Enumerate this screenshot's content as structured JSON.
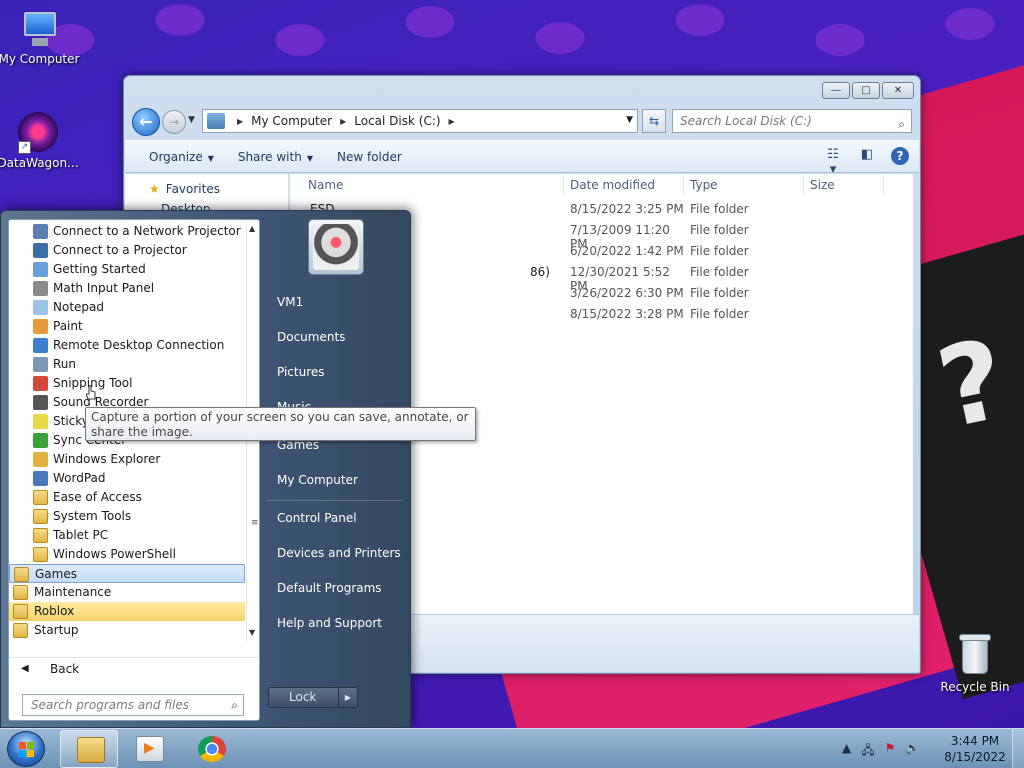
{
  "desktop": {
    "icons": [
      {
        "label": "My Computer",
        "icon": "computer-icon"
      },
      {
        "label": "DataWagon...",
        "icon": "datawagon-icon"
      },
      {
        "label": "Recycle Bin",
        "icon": "recycle-bin-icon"
      }
    ]
  },
  "explorer": {
    "window_controls": {
      "minimize": "—",
      "maximize": "□",
      "close": "✕"
    },
    "address": {
      "parts": [
        "My Computer",
        "Local Disk (C:)"
      ],
      "separator": "▶"
    },
    "search_placeholder": "Search Local Disk (C:)",
    "toolbar": {
      "organize": "Organize",
      "share_with": "Share with",
      "new_folder": "New folder"
    },
    "nav_pane": {
      "favorites": "Favorites",
      "desktop": "Desktop"
    },
    "columns": {
      "name": "Name",
      "date": "Date modified",
      "type": "Type",
      "size": "Size"
    },
    "files": [
      {
        "name": "ESD",
        "date": "8/15/2022 3:25 PM",
        "type": "File folder"
      },
      {
        "name": "",
        "date": "7/13/2009 11:20 PM",
        "type": "File folder"
      },
      {
        "name": "",
        "date": "6/20/2022 1:42 PM",
        "type": "File folder"
      },
      {
        "name": "86)",
        "date": "12/30/2021 5:52 PM",
        "type": "File folder"
      },
      {
        "name": "",
        "date": "3/26/2022 6:30 PM",
        "type": "File folder"
      },
      {
        "name": "",
        "date": "8/15/2022 3:28 PM",
        "type": "File folder"
      }
    ]
  },
  "start_menu": {
    "programs": [
      {
        "label": "Connect to a Network Projector",
        "icon": "network-projector-icon",
        "color": "#5a7fb0",
        "kind": "item"
      },
      {
        "label": "Connect to a Projector",
        "icon": "projector-icon",
        "color": "#3a6ea5",
        "kind": "item"
      },
      {
        "label": "Getting Started",
        "icon": "getting-started-icon",
        "color": "#6aa0d8",
        "kind": "item"
      },
      {
        "label": "Math Input Panel",
        "icon": "math-input-icon",
        "color": "#8a8a8a",
        "kind": "item"
      },
      {
        "label": "Notepad",
        "icon": "notepad-icon",
        "color": "#9cc2e5",
        "kind": "item"
      },
      {
        "label": "Paint",
        "icon": "paint-icon",
        "color": "#e69a3a",
        "kind": "item"
      },
      {
        "label": "Remote Desktop Connection",
        "icon": "remote-desktop-icon",
        "color": "#3f7ecf",
        "kind": "item"
      },
      {
        "label": "Run",
        "icon": "run-icon",
        "color": "#7c97b6",
        "kind": "item"
      },
      {
        "label": "Snipping Tool",
        "icon": "snipping-tool-icon",
        "color": "#d24a3a",
        "kind": "item"
      },
      {
        "label": "Sound Recorder",
        "icon": "sound-recorder-icon",
        "color": "#555555",
        "kind": "item"
      },
      {
        "label": "Sticky Notes",
        "icon": "sticky-notes-icon",
        "color": "#e8d84a",
        "kind": "item"
      },
      {
        "label": "Sync Center",
        "icon": "sync-center-icon",
        "color": "#3aa03a",
        "kind": "item"
      },
      {
        "label": "Windows Explorer",
        "icon": "windows-explorer-icon",
        "color": "#e0b040",
        "kind": "item"
      },
      {
        "label": "WordPad",
        "icon": "wordpad-icon",
        "color": "#4a78b8",
        "kind": "item"
      },
      {
        "label": "Ease of Access",
        "icon": "folder-icon",
        "color": "#e2b446",
        "kind": "folder"
      },
      {
        "label": "System Tools",
        "icon": "folder-icon",
        "color": "#e2b446",
        "kind": "folder"
      },
      {
        "label": "Tablet PC",
        "icon": "folder-icon",
        "color": "#e2b446",
        "kind": "folder"
      },
      {
        "label": "Windows PowerShell",
        "icon": "folder-icon",
        "color": "#e2b446",
        "kind": "folder"
      },
      {
        "label": "Games",
        "icon": "folder-icon",
        "color": "#e2b446",
        "kind": "top-selected"
      },
      {
        "label": "Maintenance",
        "icon": "folder-icon",
        "color": "#e2b446",
        "kind": "top"
      },
      {
        "label": "Roblox",
        "icon": "folder-icon",
        "color": "#e2b446",
        "kind": "top-new"
      },
      {
        "label": "Startup",
        "icon": "folder-icon",
        "color": "#e2b446",
        "kind": "top"
      }
    ],
    "back_label": "Back",
    "search_placeholder": "Search programs and files",
    "right_items": {
      "user": "VM1",
      "documents": "Documents",
      "pictures": "Pictures",
      "music": "Music",
      "games": "Games",
      "computer": "My Computer",
      "control_panel": "Control Panel",
      "devices": "Devices and Printers",
      "defaults": "Default Programs",
      "help": "Help and Support"
    },
    "lock_label": "Lock"
  },
  "tooltip": {
    "text": "Capture a portion of your screen so you can save, annotate, or share the image."
  },
  "taskbar": {
    "pinned": [
      {
        "name": "Windows Explorer",
        "icon": "explorer-taskbar-icon",
        "active": true
      },
      {
        "name": "Windows Media Player",
        "icon": "media-player-icon",
        "active": false
      },
      {
        "name": "Google Chrome",
        "icon": "chrome-icon",
        "active": false
      }
    ],
    "tray": {
      "expand": "▲",
      "flag": "⚑",
      "network": "🖧",
      "volume": "🔈"
    },
    "time": "3:44 PM",
    "date": "8/15/2022"
  }
}
